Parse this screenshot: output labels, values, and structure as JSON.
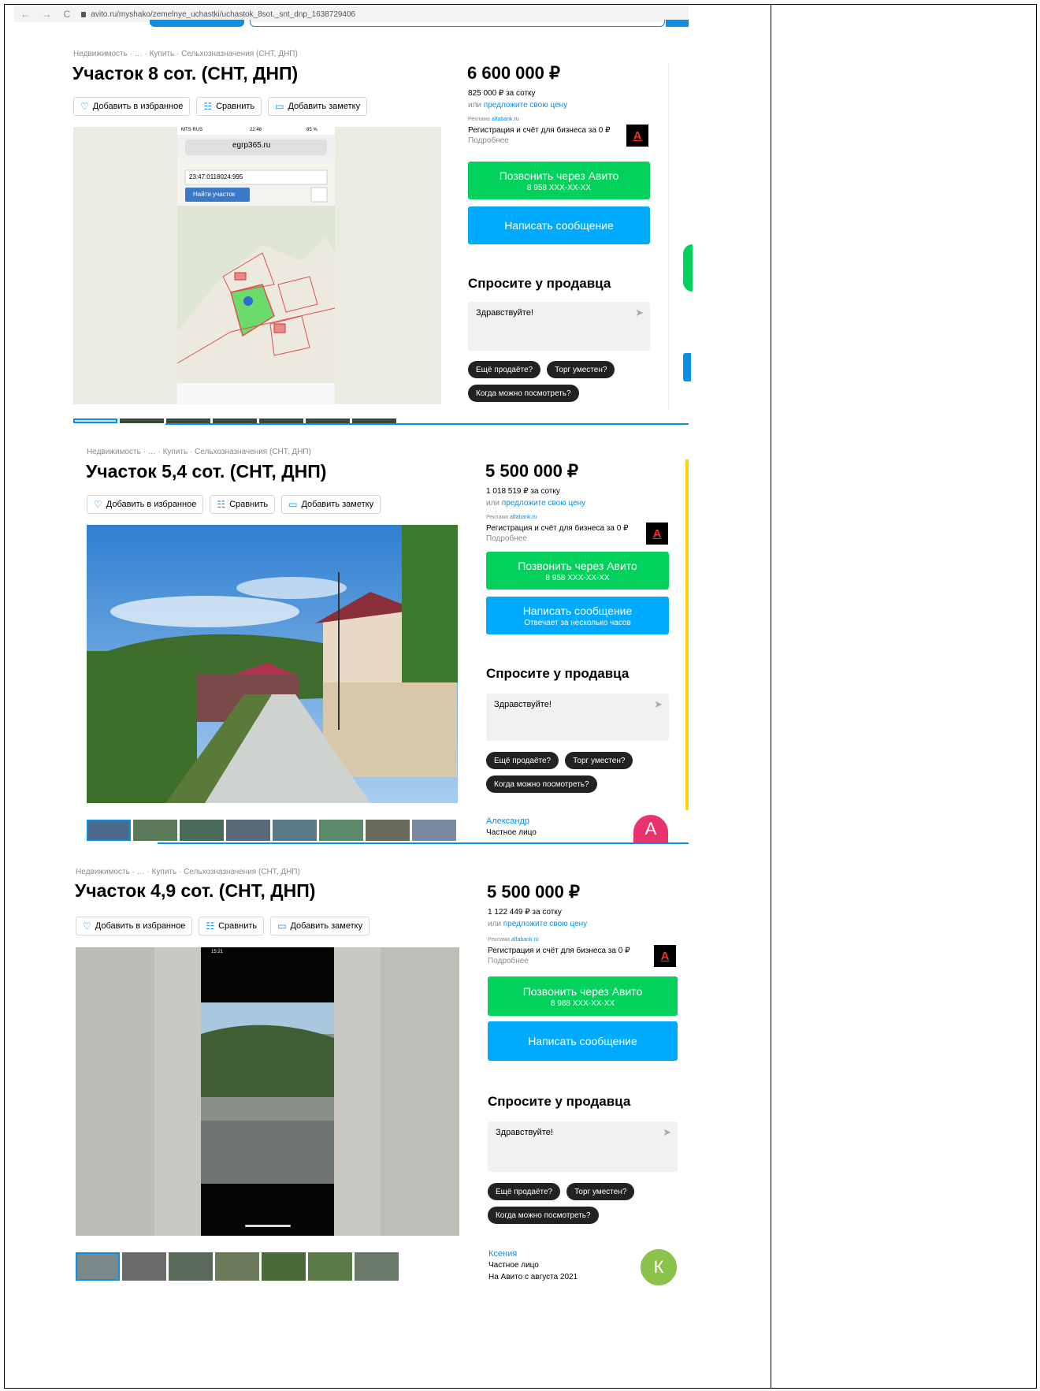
{
  "browser": {
    "url": "avito.ru/myshako/zemelnye_uchastki/uchastok_8sot._snt_dnp_1638729406"
  },
  "listings": [
    {
      "breadcrumb": "Недвижимость · … · Купить · Сельхозназначения (СНТ, ДНП)",
      "title": "Участок 8 сот. (СНТ, ДНП)",
      "actions": [
        "Добавить в избранное",
        "Сравнить",
        "Добавить заметку"
      ],
      "price": "6 600 000 ₽",
      "per_sotka": "825 000 ₽ за сотку",
      "offer_prefix": "или",
      "offer_link": "предложите свою цену",
      "ad_label": "Реклама",
      "ad_domain": "alfabank.ru",
      "ad_text": "Регистрация и счёт для бизнеса за 0 ₽",
      "ad_more": "Подробнее",
      "call_label": "Позвонить через Авито",
      "call_phone": "8 958 XXX-XX-XX",
      "msg_label": "Написать сообщение",
      "msg_sub": "",
      "ask_heading": "Спросите у продавца",
      "ask_text": "Здравствуйте!",
      "chips": [
        "Ещё продаёте?",
        "Торг уместен?",
        "Когда можно посмотреть?"
      ],
      "photo": {
        "status_carrier": "MTS RUS",
        "status_time": "22:48",
        "status_battery": "85 %",
        "site": "egrp365.ru",
        "cadastral": "23:47:0118024:995",
        "find_button": "Найти участок"
      }
    },
    {
      "breadcrumb": "Недвижимость · … · Купить · Сельхозназначения (СНТ, ДНП)",
      "title": "Участок 5,4 сот. (СНТ, ДНП)",
      "actions": [
        "Добавить в избранное",
        "Сравнить",
        "Добавить заметку"
      ],
      "price": "5 500 000 ₽",
      "per_sotka": "1 018 519 ₽ за сотку",
      "offer_prefix": "или",
      "offer_link": "предложите свою цену",
      "ad_label": "Реклама",
      "ad_domain": "alfabank.ru",
      "ad_text": "Регистрация и счёт для бизнеса за 0 ₽",
      "ad_more": "Подробнее",
      "call_label": "Позвонить через Авито",
      "call_phone": "8 958 XXX-XX-XX",
      "msg_label": "Написать сообщение",
      "msg_sub": "Отвечает за несколько часов",
      "ask_heading": "Спросите у продавца",
      "ask_text": "Здравствуйте!",
      "chips": [
        "Ещё продаёте?",
        "Торг уместен?",
        "Когда можно посмотреть?"
      ],
      "seller": {
        "name": "Александр",
        "type": "Частное лицо",
        "initial": "А",
        "color": "#e8336d"
      }
    },
    {
      "breadcrumb": "Недвижимость · … · Купить · Сельхозназначения (СНТ, ДНП)",
      "title": "Участок 4,9 сот. (СНТ, ДНП)",
      "actions": [
        "Добавить в избранное",
        "Сравнить",
        "Добавить заметку"
      ],
      "price": "5 500 000 ₽",
      "per_sotka": "1 122 449 ₽ за сотку",
      "offer_prefix": "или",
      "offer_link": "предложите свою цену",
      "ad_label": "Реклама",
      "ad_domain": "alfabank.ru",
      "ad_text": "Регистрация и счёт для бизнеса за 0 ₽",
      "ad_more": "Подробнее",
      "call_label": "Позвонить через Авито",
      "call_phone": "8 988 XXX-XX-XX",
      "msg_label": "Написать сообщение",
      "msg_sub": "",
      "ask_heading": "Спросите у продавца",
      "ask_text": "Здравствуйте!",
      "chips": [
        "Ещё продаёте?",
        "Торг уместен?",
        "Когда можно посмотреть?"
      ],
      "photo": {
        "status_time": "15:21"
      },
      "seller": {
        "name": "Ксения",
        "type": "Частное лицо",
        "since": "На Авито с августа 2021",
        "initial": "К",
        "color": "#8bc34a"
      }
    }
  ]
}
